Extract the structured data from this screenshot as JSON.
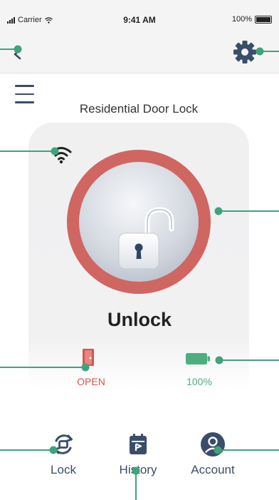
{
  "status_bar": {
    "carrier": "Carrier",
    "time": "9:41 AM",
    "battery": "100%"
  },
  "header": {
    "title": "Residential Door Lock"
  },
  "lock": {
    "action_label": "Unlock",
    "ring_color": "#d06662"
  },
  "status": {
    "door": "OPEN",
    "door_color": "#d4564f",
    "battery": "100%",
    "battery_color": "#4caf7d"
  },
  "tabs": [
    {
      "label": "Lock",
      "icon": "lock-rotate-icon"
    },
    {
      "label": "History",
      "icon": "calendar-icon"
    },
    {
      "label": "Account",
      "icon": "user-icon"
    }
  ],
  "colors": {
    "accent": "#3a4d6b",
    "callout": "#3fa37b"
  }
}
